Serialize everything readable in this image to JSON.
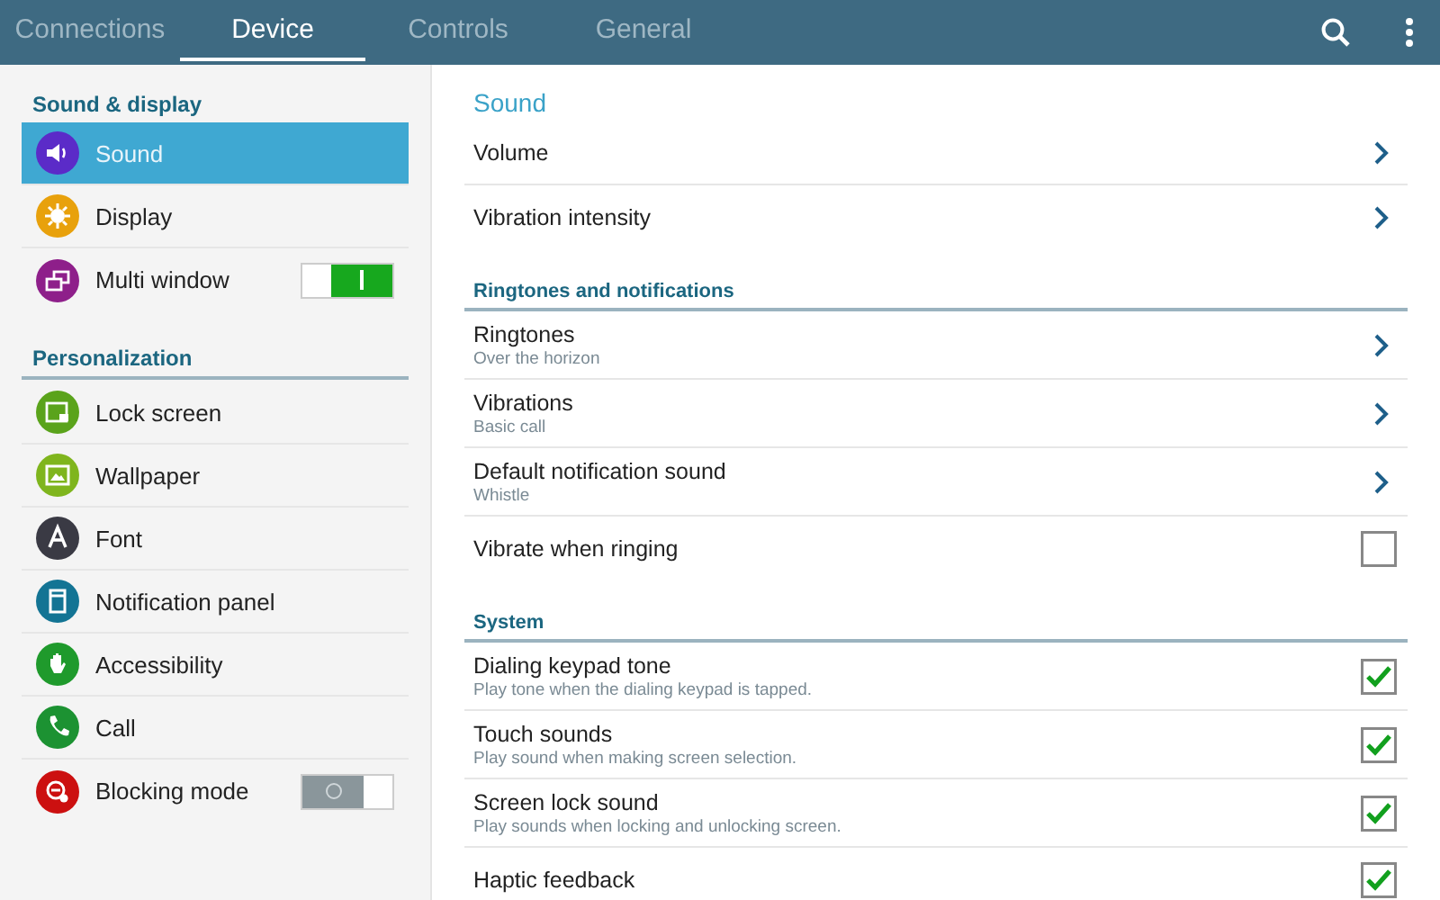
{
  "tabs": [
    {
      "label": "Connections",
      "selected": false
    },
    {
      "label": "Device",
      "selected": true
    },
    {
      "label": "Controls",
      "selected": false
    },
    {
      "label": "General",
      "selected": false
    }
  ],
  "sidebar": {
    "groups": [
      {
        "title": "Sound & display",
        "items": [
          {
            "label": "Sound",
            "color": "#5b2bc8",
            "kind": "nav",
            "selected": true
          },
          {
            "label": "Display",
            "color": "#e8a10c",
            "kind": "nav",
            "selected": false
          },
          {
            "label": "Multi window",
            "color": "#8e1f8a",
            "kind": "toggle",
            "on": true,
            "selected": false
          }
        ]
      },
      {
        "title": "Personalization",
        "items": [
          {
            "label": "Lock screen",
            "color": "#5aa31b",
            "kind": "nav",
            "selected": false
          },
          {
            "label": "Wallpaper",
            "color": "#7fb51d",
            "kind": "nav",
            "selected": false
          },
          {
            "label": "Font",
            "color": "#3a3a44",
            "kind": "nav",
            "selected": false
          },
          {
            "label": "Notification panel",
            "color": "#137494",
            "kind": "nav",
            "selected": false
          },
          {
            "label": "Accessibility",
            "color": "#1f9a2c",
            "kind": "nav",
            "selected": false
          },
          {
            "label": "Call",
            "color": "#1c9232",
            "kind": "nav",
            "selected": false
          },
          {
            "label": "Blocking mode",
            "color": "#cc1010",
            "kind": "toggle",
            "on": false,
            "selected": false
          }
        ]
      }
    ]
  },
  "content": {
    "sections": [
      {
        "kind": "title",
        "title": "Sound",
        "rows": [
          {
            "kind": "link",
            "label": "Volume"
          },
          {
            "kind": "link",
            "label": "Vibration intensity"
          }
        ]
      },
      {
        "kind": "category",
        "title": "Ringtones and notifications",
        "rows": [
          {
            "kind": "link",
            "label": "Ringtones",
            "summary": "Over the horizon"
          },
          {
            "kind": "link",
            "label": "Vibrations",
            "summary": "Basic call"
          },
          {
            "kind": "link",
            "label": "Default notification sound",
            "summary": "Whistle"
          },
          {
            "kind": "checkbox",
            "label": "Vibrate when ringing",
            "checked": false
          }
        ]
      },
      {
        "kind": "category",
        "title": "System",
        "rows": [
          {
            "kind": "checkbox",
            "label": "Dialing keypad tone",
            "summary": "Play tone when the dialing keypad is tapped.",
            "checked": true
          },
          {
            "kind": "checkbox",
            "label": "Touch sounds",
            "summary": "Play sound when making screen selection.",
            "checked": true
          },
          {
            "kind": "checkbox",
            "label": "Screen lock sound",
            "summary": "Play sounds when locking and unlocking screen.",
            "checked": true
          },
          {
            "kind": "checkbox",
            "label": "Haptic feedback",
            "checked": true
          }
        ]
      }
    ]
  }
}
